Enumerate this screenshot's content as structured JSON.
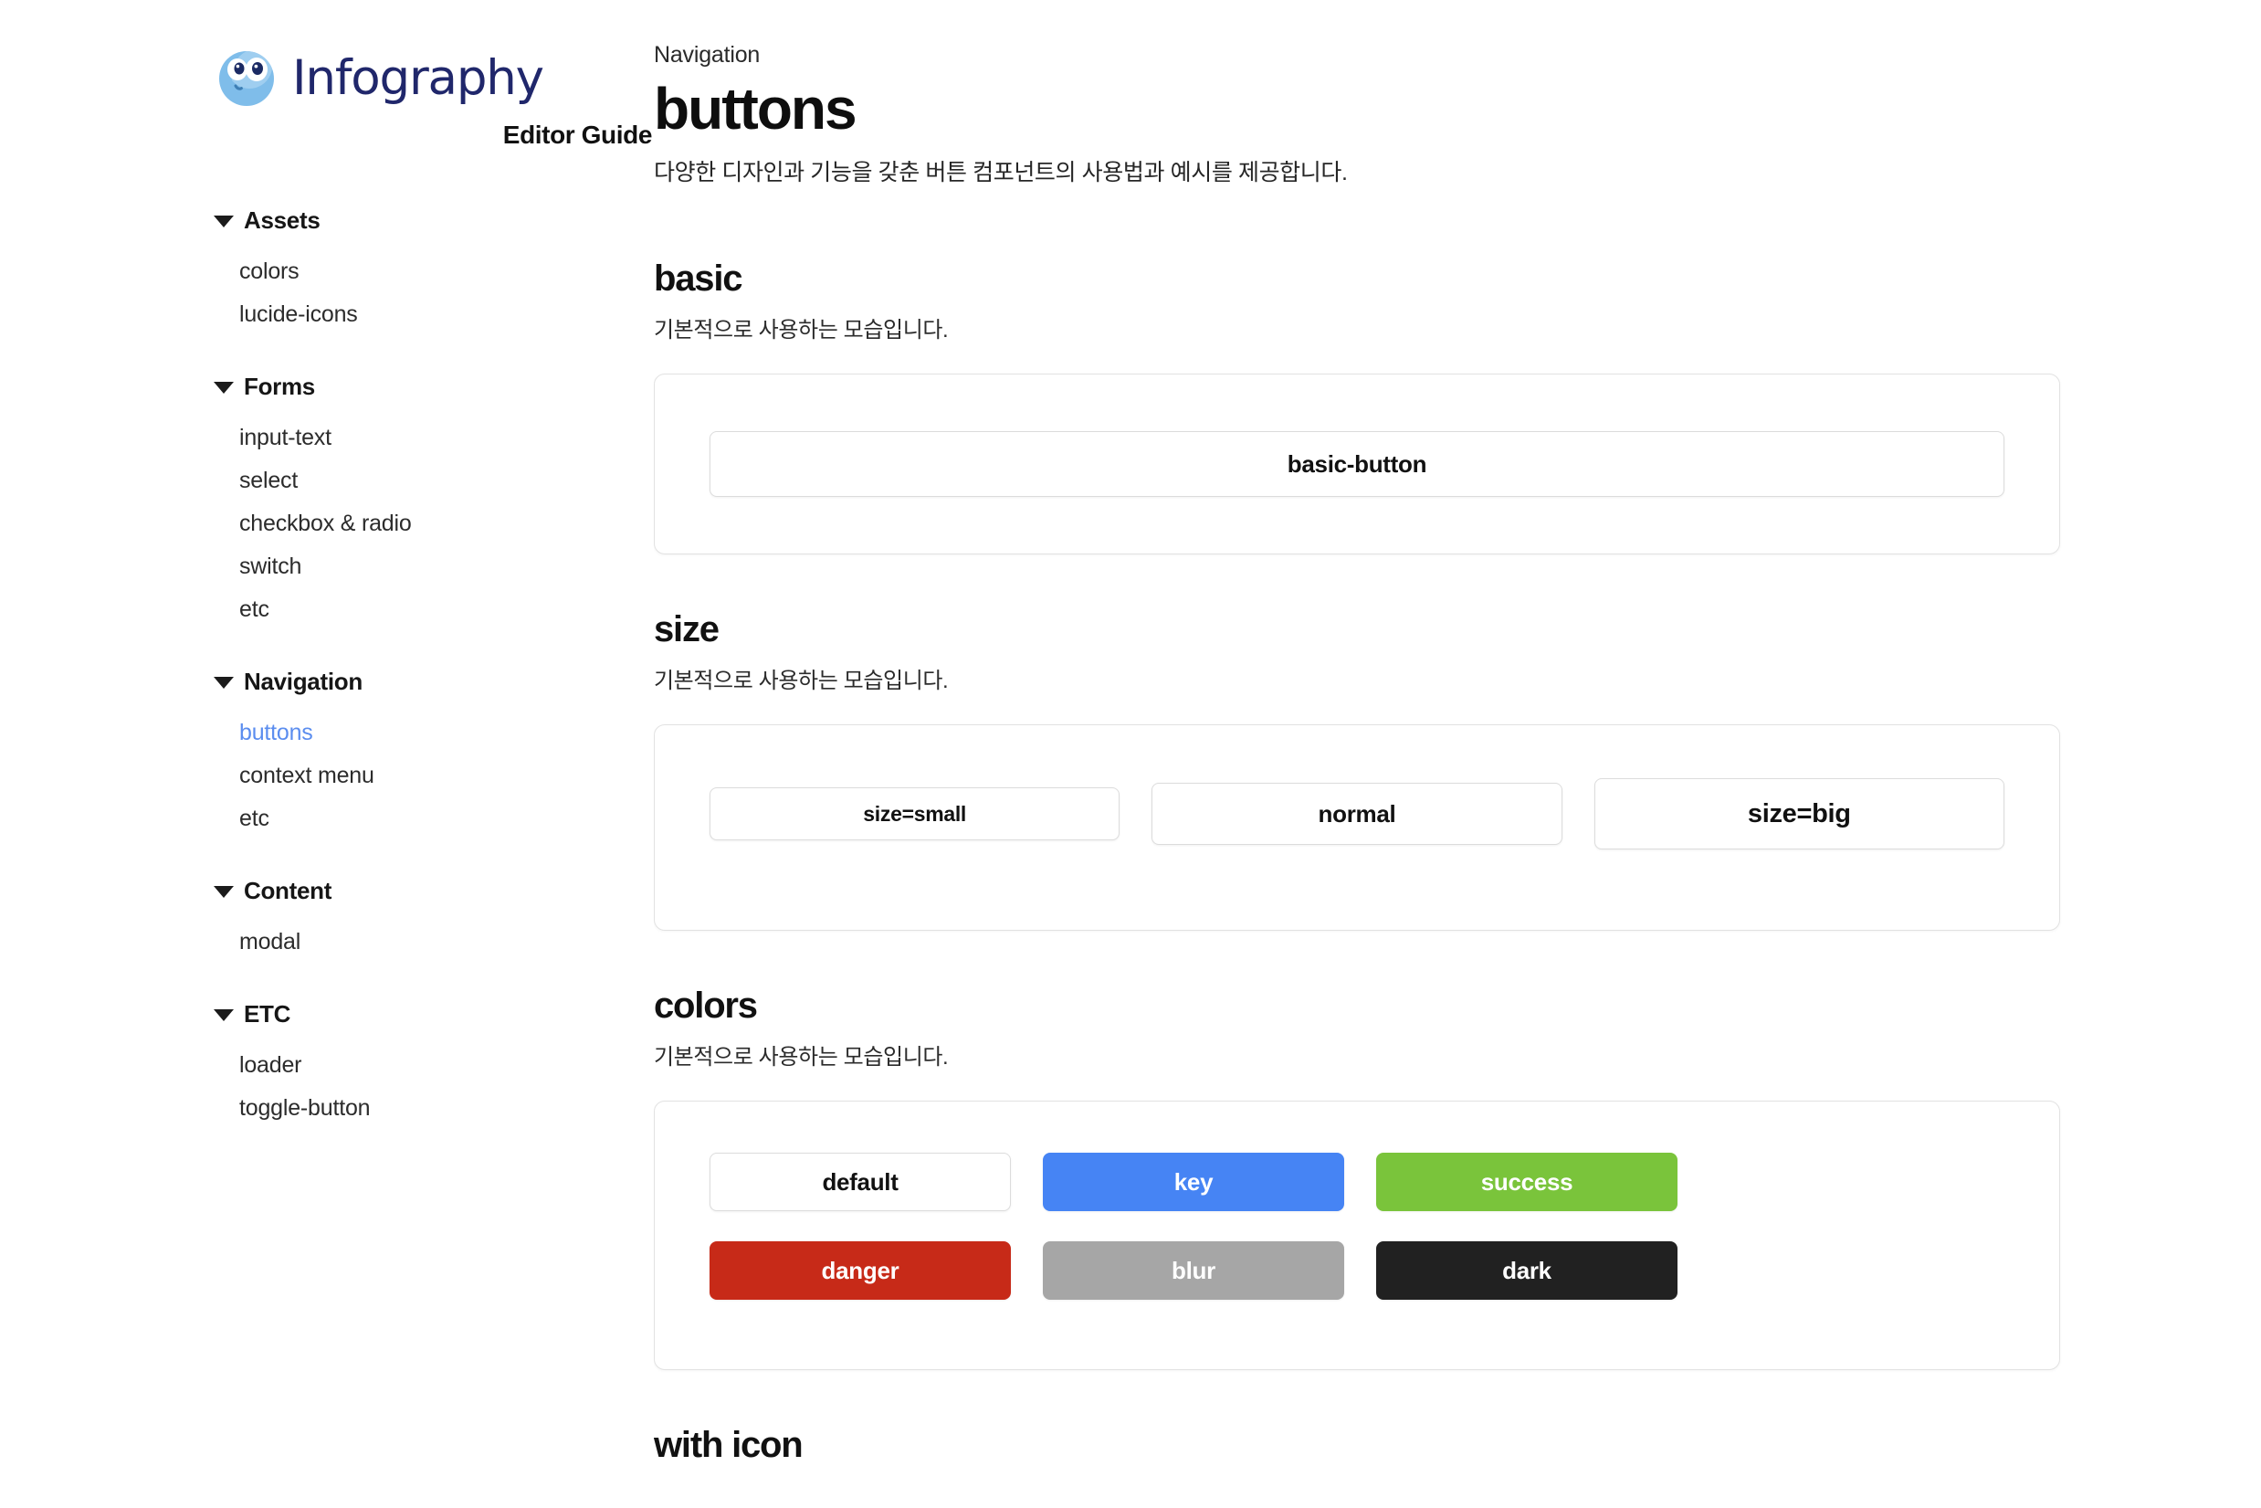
{
  "brand": {
    "name": "Infography",
    "subtitle": "Editor Guide",
    "logo_icon": "infography-mascot-icon",
    "logo_colors": {
      "face": "#7FBDEA",
      "highlight": "#A9D4F2",
      "pupil": "#1B2A63",
      "wordmark": "#20276B"
    }
  },
  "sidebar": {
    "groups": [
      {
        "title": "Assets",
        "caret_icon": "caret-down-icon",
        "items": [
          {
            "label": "colors",
            "active": false
          },
          {
            "label": "lucide-icons",
            "active": false
          }
        ]
      },
      {
        "title": "Forms",
        "caret_icon": "caret-down-icon",
        "items": [
          {
            "label": "input-text",
            "active": false
          },
          {
            "label": "select",
            "active": false
          },
          {
            "label": "checkbox & radio",
            "active": false
          },
          {
            "label": "switch",
            "active": false
          },
          {
            "label": "etc",
            "active": false
          }
        ]
      },
      {
        "title": "Navigation",
        "caret_icon": "caret-down-icon",
        "items": [
          {
            "label": "buttons",
            "active": true
          },
          {
            "label": "context menu",
            "active": false
          },
          {
            "label": "etc",
            "active": false
          }
        ]
      },
      {
        "title": "Content",
        "caret_icon": "caret-down-icon",
        "items": [
          {
            "label": "modal",
            "active": false
          }
        ]
      },
      {
        "title": "ETC",
        "caret_icon": "caret-down-icon",
        "items": [
          {
            "label": "loader",
            "active": false
          },
          {
            "label": "toggle-button",
            "active": false
          }
        ]
      }
    ],
    "active_color": "#5B8DEF"
  },
  "header": {
    "breadcrumb": "Navigation",
    "title": "buttons",
    "description": "다양한 디자인과 기능을 갖춘 버튼 컴포넌트의 사용법과 예시를 제공합니다."
  },
  "sections": {
    "basic": {
      "title": "basic",
      "description": "기본적으로 사용하는 모습입니다.",
      "button_label": "basic-button"
    },
    "size": {
      "title": "size",
      "description": "기본적으로 사용하는 모습입니다.",
      "buttons": [
        {
          "label": "size=small",
          "size": "small"
        },
        {
          "label": "normal",
          "size": "normal"
        },
        {
          "label": "size=big",
          "size": "big"
        }
      ]
    },
    "colors": {
      "title": "colors",
      "description": "기본적으로 사용하는 모습입니다.",
      "buttons": [
        {
          "label": "default",
          "bg": "#FFFFFF",
          "fg": "#111111",
          "border": "#DCDCDC"
        },
        {
          "label": "key",
          "bg": "#4684F4",
          "fg": "#FFFFFF",
          "border": "#4684F4"
        },
        {
          "label": "success",
          "bg": "#7AC43B",
          "fg": "#FFFFFF",
          "border": "#7AC43B"
        },
        {
          "label": "danger",
          "bg": "#C72A18",
          "fg": "#FFFFFF",
          "border": "#C72A18"
        },
        {
          "label": "blur",
          "bg": "#A6A6A6",
          "fg": "#FFFFFF",
          "border": "#A6A6A6"
        },
        {
          "label": "dark",
          "bg": "#212121",
          "fg": "#FFFFFF",
          "border": "#212121"
        }
      ]
    },
    "with_icon": {
      "title": "with icon"
    }
  }
}
